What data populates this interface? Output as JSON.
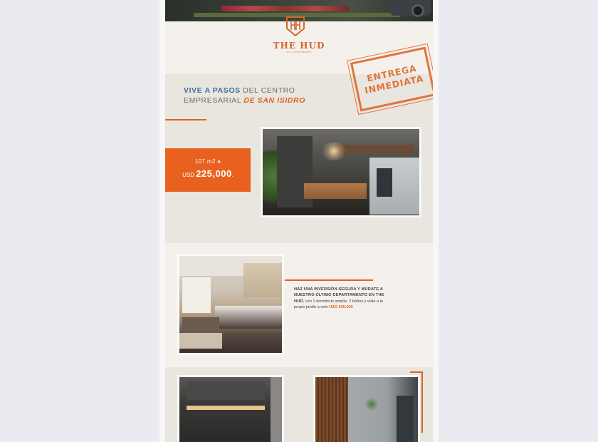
{
  "brand": {
    "logo_monogram": "H",
    "name": "THE HUD",
    "tagline": "CITY APARTMENTS"
  },
  "hero": {
    "icon": "street-photo"
  },
  "section1": {
    "headline_blue": "VIVE A PASOS",
    "headline_gray_1": " DEL CENTRO",
    "headline_gray_2": "EMPRESARIAL ",
    "headline_connector": "DE ",
    "headline_orange": "SAN ISIDRO",
    "stamp_line1": "ENTREGA",
    "stamp_line2": "INMEDIATA",
    "price_area": "107 m2  a",
    "price_currency": "USD ",
    "price_value": "225,000",
    "price_suffix": ".",
    "image_icon": "lobby-photo"
  },
  "section2": {
    "text_bold": "HAZ UNA INVERSIÓN SEGURA Y MÚDATE A NUESTRO ÚLTIMO DEPARTAMENTO EN THE HUD",
    "text_normal": ", con 1 dormitorio amplio, 2 baños y vista a tu propio jardín a solo ",
    "text_price": "USD 225,000",
    "image_icon": "bedroom-photo"
  },
  "section3": {
    "image_left_icon": "kitchen-photo",
    "image_right_icon": "bathroom-photo"
  },
  "colors": {
    "accent": "#e0621f",
    "blue": "#3b6e98",
    "background": "#f4f1ec"
  }
}
